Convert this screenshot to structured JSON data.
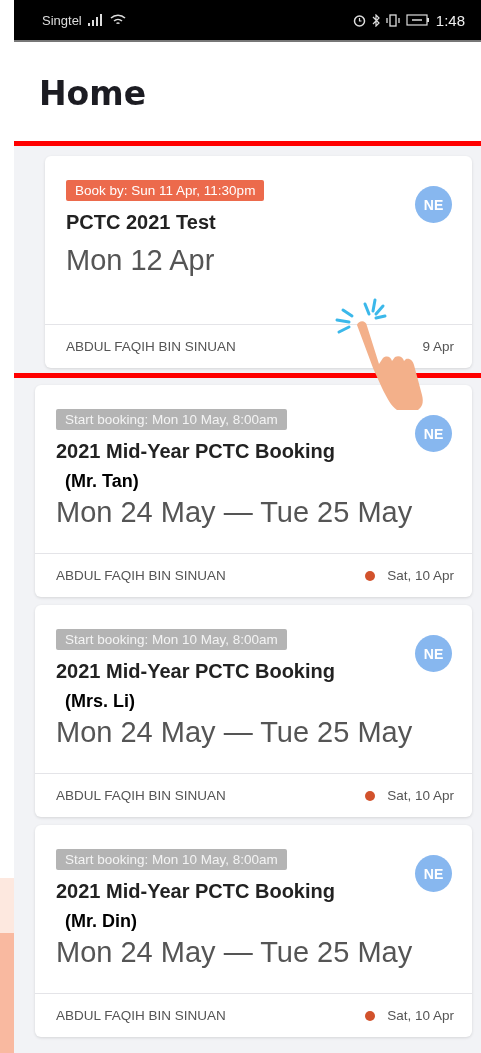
{
  "status_bar": {
    "carrier": "Singtel",
    "time": "1:48"
  },
  "header": {
    "title": "Home"
  },
  "cards": [
    {
      "tag": {
        "kind": "deadline",
        "text": "Book by: Sun 11 Apr, 11:30pm"
      },
      "title": "PCTC 2021 Test",
      "date": "Mon 12 Apr",
      "avatar": "NE",
      "owner": "ABDUL FAQIH BIN SINUAN",
      "updated": "9 Apr"
    },
    {
      "tag": {
        "kind": "upcoming",
        "text": "Start booking: Mon 10 May, 8:00am"
      },
      "title": "2021 Mid-Year PCTC Booking",
      "note": "(Mr. Tan)",
      "date": "Mon 24 May — Tue 25 May",
      "avatar": "NE",
      "owner": "ABDUL FAQIH BIN SINUAN",
      "color": "#d2522c",
      "updated": "Sat, 10 Apr"
    },
    {
      "tag": {
        "kind": "upcoming",
        "text": "Start booking: Mon 10 May, 8:00am"
      },
      "title": "2021 Mid-Year PCTC Booking",
      "note": "(Mrs. Li)",
      "date": "Mon 24 May — Tue 25 May",
      "avatar": "NE",
      "owner": "ABDUL FAQIH BIN SINUAN",
      "color": "#d2522c",
      "updated": "Sat, 10 Apr"
    },
    {
      "tag": {
        "kind": "upcoming",
        "text": "Start booking: Mon 10 May, 8:00am"
      },
      "title": "2021 Mid-Year PCTC Booking",
      "note": "(Mr. Din)",
      "date": "Mon 24 May — Tue 25 May",
      "avatar": "NE",
      "owner": "ABDUL FAQIH BIN SINUAN",
      "color": "#d2522c",
      "updated": "Sat, 10 Apr"
    }
  ]
}
